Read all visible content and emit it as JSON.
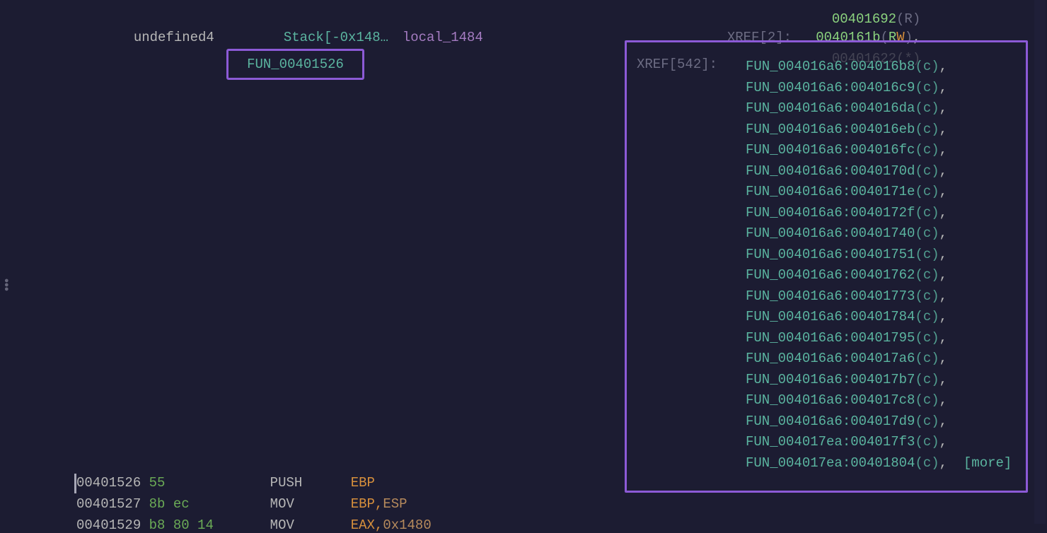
{
  "header_line": {
    "type": "undefined4",
    "storage": "Stack[-0x148…",
    "name": "local_1484"
  },
  "top_right": {
    "partial_addr": "00401692",
    "partial_flag": "(R)",
    "xref_label": "XREF[2]:",
    "xref_addr": "0040161b",
    "xref_flag_r": "R",
    "xref_flag_w": "W",
    "dim_addr": "00401622",
    "dim_flag": "(*)"
  },
  "fn_name": "FUN_00401526",
  "xref542_label": "XREF[542]:",
  "xref542_list": [
    "FUN_004016a6:004016b8(c)",
    "FUN_004016a6:004016c9(c)",
    "FUN_004016a6:004016da(c)",
    "FUN_004016a6:004016eb(c)",
    "FUN_004016a6:004016fc(c)",
    "FUN_004016a6:0040170d(c)",
    "FUN_004016a6:0040171e(c)",
    "FUN_004016a6:0040172f(c)",
    "FUN_004016a6:00401740(c)",
    "FUN_004016a6:00401751(c)",
    "FUN_004016a6:00401762(c)",
    "FUN_004016a6:00401773(c)",
    "FUN_004016a6:00401784(c)",
    "FUN_004016a6:00401795(c)",
    "FUN_004016a6:004017a6(c)",
    "FUN_004016a6:004017b7(c)",
    "FUN_004016a6:004017c8(c)",
    "FUN_004016a6:004017d9(c)",
    "FUN_004017ea:004017f3(c)",
    "FUN_004017ea:00401804(c)"
  ],
  "more_label": "[more]",
  "asm": [
    {
      "addr": "00401526",
      "bytes": "55",
      "mn": "PUSH",
      "op": "EBP"
    },
    {
      "addr": "00401527",
      "bytes": "8b ec",
      "mn": "MOV",
      "op": "EBP,",
      "op2": "ESP"
    },
    {
      "addr": "00401529",
      "bytes": "b8 80 14",
      "mn": "MOV",
      "op": "EAX,",
      "op2": "0x1480"
    }
  ]
}
